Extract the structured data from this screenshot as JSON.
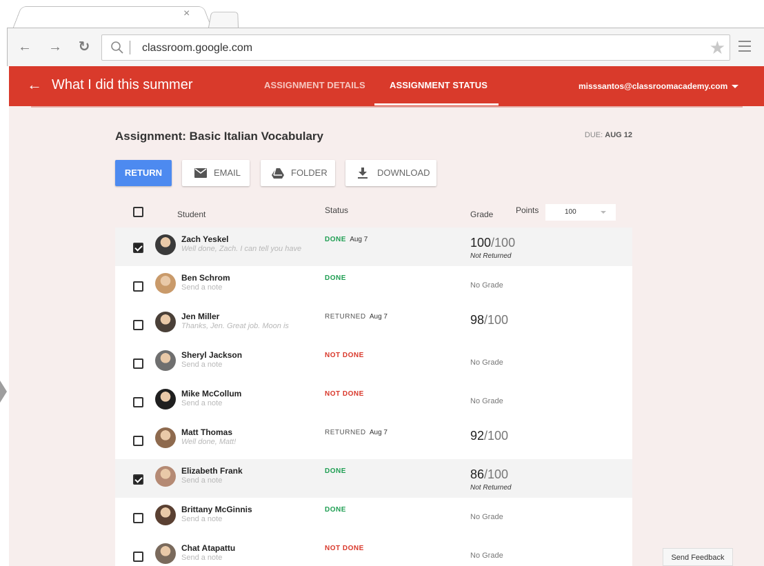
{
  "browser": {
    "tab_close": "×",
    "url": "classroom.google.com"
  },
  "appbar": {
    "course_title": "What I did this summer",
    "tabs": [
      {
        "label": "ASSIGNMENT DETAILS",
        "active": false
      },
      {
        "label": "ASSIGNMENT STATUS",
        "active": true
      }
    ],
    "account": "misssantos@classroomacademy.com",
    "color": "#d93a2b"
  },
  "assignment": {
    "title": "Assignment: Basic Italian Vocabulary",
    "due_label": "DUE:",
    "due_date": "AUG 12"
  },
  "actions": {
    "return_label": "RETURN",
    "email_label": "EMAIL",
    "folder_label": "FOLDER",
    "download_label": "DOWNLOAD"
  },
  "table": {
    "columns": {
      "student": "Student",
      "status": "Status",
      "grade": "Grade",
      "points": "Points"
    },
    "points_value": "100",
    "rows": [
      {
        "name": "Zach Yeskel",
        "note": "Well done, Zach. I can tell you have",
        "note_italic": true,
        "checked": true,
        "status": "DONE",
        "status_kind": "done",
        "date": "Aug 7",
        "grade": "100",
        "grade_max": "/100",
        "grade_sub": "Not Returned",
        "no_grade": ""
      },
      {
        "name": "Ben Schrom",
        "note": "Send a note",
        "note_italic": false,
        "checked": false,
        "status": "DONE",
        "status_kind": "done",
        "date": "",
        "grade": "",
        "grade_max": "",
        "grade_sub": "",
        "no_grade": "No Grade"
      },
      {
        "name": "Jen Miller",
        "note": "Thanks, Jen. Great job. Moon is",
        "note_italic": true,
        "checked": false,
        "status": "RETURNED",
        "status_kind": "returned",
        "date": "Aug 7",
        "grade": "98",
        "grade_max": "/100",
        "grade_sub": "",
        "no_grade": ""
      },
      {
        "name": "Sheryl Jackson",
        "note": "Send a note",
        "note_italic": false,
        "checked": false,
        "status": "NOT DONE",
        "status_kind": "notdone",
        "date": "",
        "grade": "",
        "grade_max": "",
        "grade_sub": "",
        "no_grade": "No Grade"
      },
      {
        "name": "Mike McCollum",
        "note": "Send a note",
        "note_italic": false,
        "checked": false,
        "status": "NOT DONE",
        "status_kind": "notdone",
        "date": "",
        "grade": "",
        "grade_max": "",
        "grade_sub": "",
        "no_grade": "No Grade"
      },
      {
        "name": "Matt Thomas",
        "note": "Well done, Matt!",
        "note_italic": true,
        "checked": false,
        "status": "RETURNED",
        "status_kind": "returned",
        "date": "Aug 7",
        "grade": "92",
        "grade_max": "/100",
        "grade_sub": "",
        "no_grade": ""
      },
      {
        "name": "Elizabeth Frank",
        "note": "Send a note",
        "note_italic": false,
        "checked": true,
        "status": "DONE",
        "status_kind": "done",
        "date": "",
        "grade": "86",
        "grade_max": "/100",
        "grade_sub": "Not Returned",
        "no_grade": ""
      },
      {
        "name": "Brittany McGinnis",
        "note": "Send a note",
        "note_italic": false,
        "checked": false,
        "status": "DONE",
        "status_kind": "done",
        "date": "",
        "grade": "",
        "grade_max": "",
        "grade_sub": "",
        "no_grade": "No Grade"
      },
      {
        "name": "Chat Atapattu",
        "note": "Send a note",
        "note_italic": false,
        "checked": false,
        "status": "NOT DONE",
        "status_kind": "notdone",
        "date": "",
        "grade": "",
        "grade_max": "",
        "grade_sub": "",
        "no_grade": "No Grade"
      }
    ]
  },
  "feedback_label": "Send Feedback",
  "colors": {
    "accent_blue": "#4d8af0",
    "done_green": "#1e9e52",
    "notdone_red": "#d9382b",
    "page_bg": "#f7eeed"
  }
}
